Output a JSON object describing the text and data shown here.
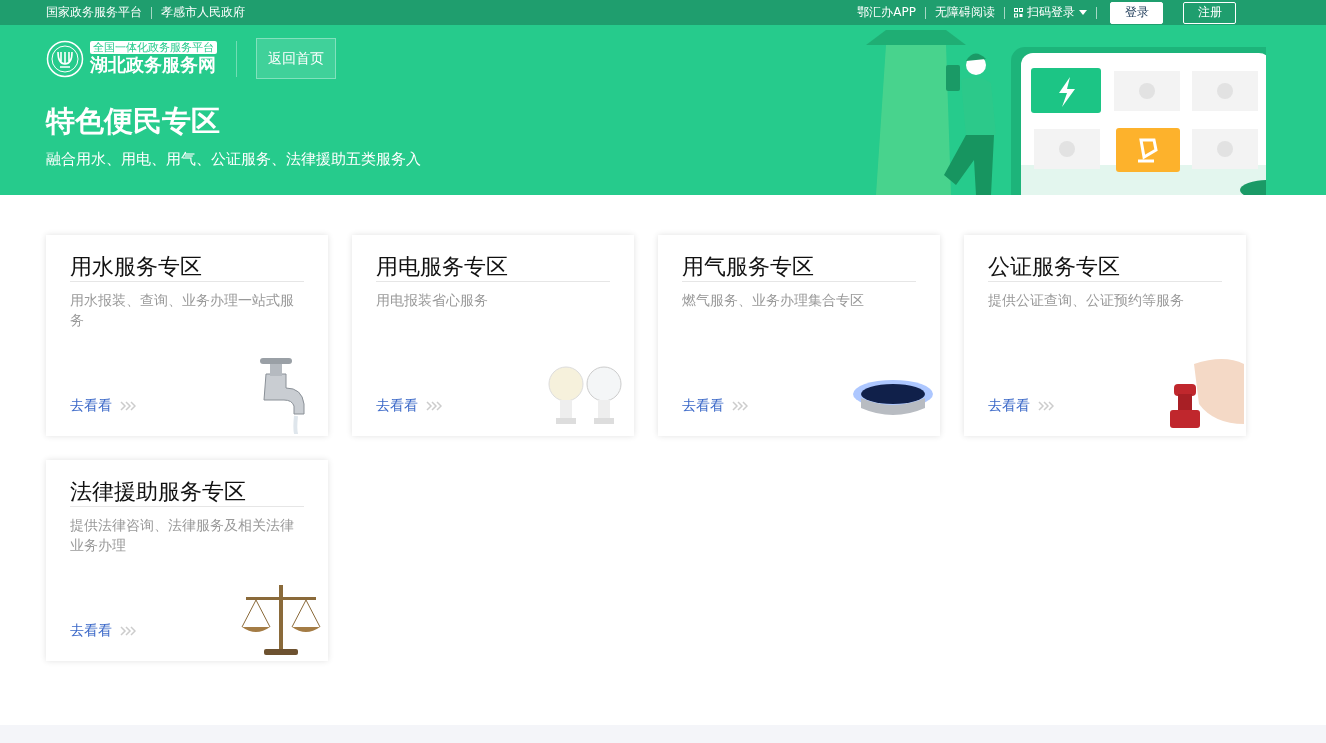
{
  "top_bar": {
    "left_links": [
      "国家政务服务平台",
      "孝感市人民政府"
    ],
    "right_links": [
      {
        "label": "鄂汇办APP",
        "kind": "text"
      },
      {
        "label": "无障碍阅读",
        "kind": "text"
      },
      {
        "label": "扫码登录",
        "kind": "qr"
      }
    ],
    "buttons": [
      {
        "label": "登录",
        "kind": "filled"
      },
      {
        "label": "注册",
        "kind": "outline"
      }
    ]
  },
  "header": {
    "logo": {
      "badge": "全国一体化政务服务平台",
      "name": "湖北政务服务网"
    },
    "home_button": "返回首页",
    "title": "特色便民专区",
    "subtitle": "融合用水、用电、用气、公证服务、法律援助五类服务入"
  },
  "cards": [
    {
      "title": "用水服务专区",
      "description": "用水报装、查询、业务办理一站式服务",
      "link": "去看看",
      "kind": "water"
    },
    {
      "title": "用电服务专区",
      "description": "用电报装省心服务",
      "link": "去看看",
      "kind": "power"
    },
    {
      "title": "用气服务专区",
      "description": "燃气服务、业务办理集合专区",
      "link": "去看看",
      "kind": "gas"
    },
    {
      "title": "公证服务专区",
      "description": "提供公证查询、公证预约等服务",
      "link": "去看看",
      "kind": "notary"
    },
    {
      "title": "法律援助服务专区",
      "description": "提供法律咨询、法律服务及相关法律业务办理",
      "link": "去看看",
      "kind": "legal"
    }
  ]
}
